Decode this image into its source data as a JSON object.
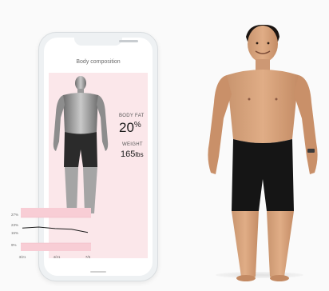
{
  "app": {
    "title": "Body composition"
  },
  "stats": {
    "body_fat_label": "BODY FAT",
    "body_fat_value": "20",
    "body_fat_unit": "%",
    "weight_label": "WEIGHT",
    "weight_value": "165",
    "weight_unit": "lbs"
  },
  "chart_data": {
    "type": "line",
    "x": [
      "3/21",
      "4/21",
      "7/5"
    ],
    "y_ticks": [
      "27%",
      "23%",
      "15%",
      "9%"
    ],
    "series": [
      {
        "values": [
          22,
          22.5,
          21.8,
          21.5,
          20
        ]
      }
    ]
  },
  "colors": {
    "panel_background": "#fbe7ea",
    "chart_band": "#f8cdd5",
    "line": "#1a1a1a",
    "phone_frame": "#eef1f3"
  }
}
